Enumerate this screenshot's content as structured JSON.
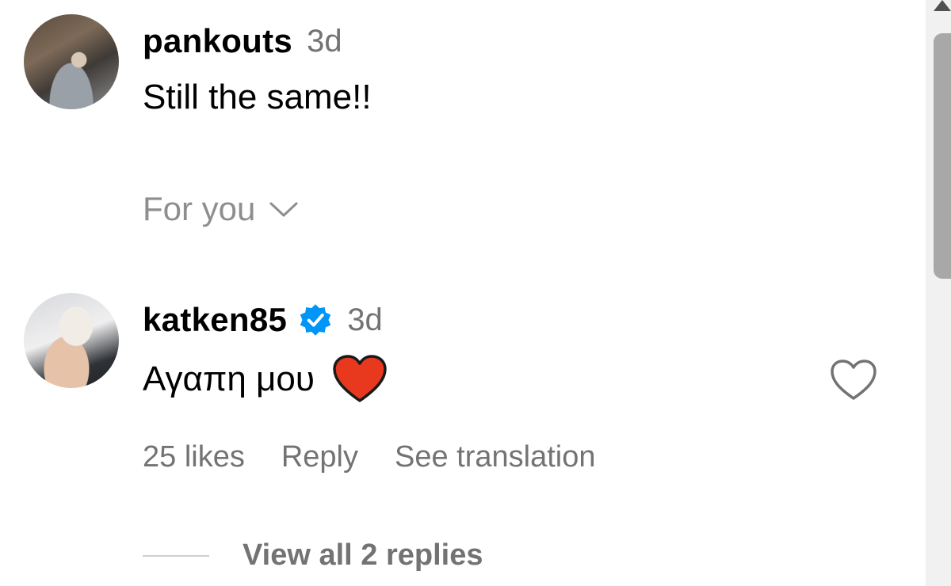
{
  "comments": [
    {
      "avatar_icon": "user-avatar-photo",
      "username": "pankouts",
      "time": "3d",
      "text": "Still the same!!"
    },
    {
      "avatar_icon": "user-avatar-photo",
      "username": "katken85",
      "verified": true,
      "time": "3d",
      "text": "Αγαπη μου",
      "emoji": "red-heart",
      "likes": "25 likes",
      "reply_label": "Reply",
      "translate_label": "See translation",
      "view_replies_label": "View all 2 replies"
    }
  ],
  "filter": {
    "label": "For you",
    "icon": "chevron-down-icon"
  },
  "colors": {
    "secondary_text": "#737373",
    "verified_blue": "#0095f6",
    "heart_red": "#e8391f",
    "scroll_thumb": "#a8a8a8"
  }
}
